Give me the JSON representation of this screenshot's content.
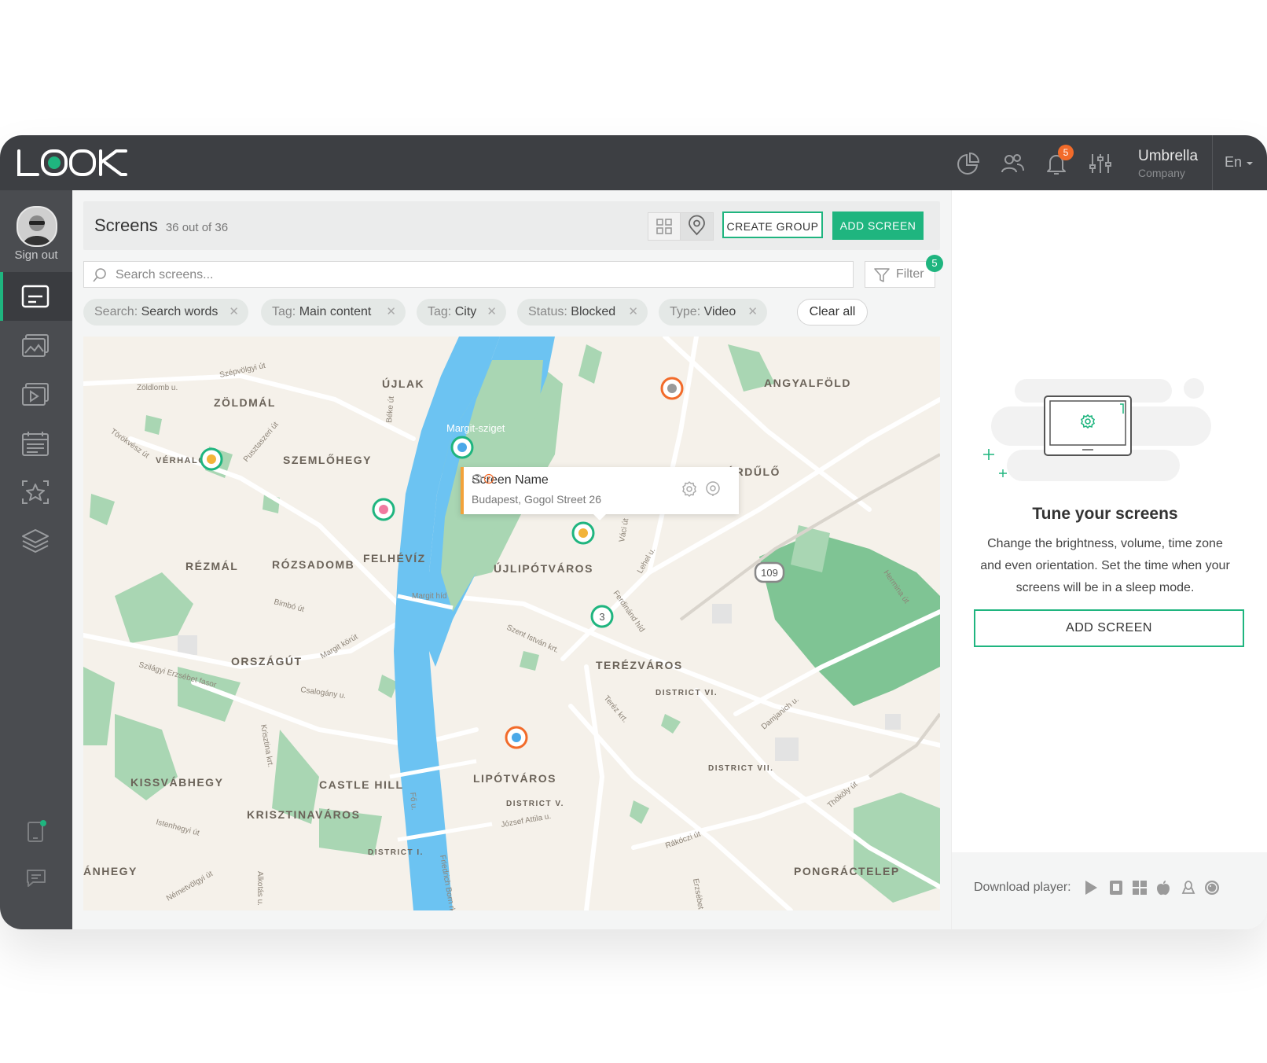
{
  "topbar": {
    "logo_text": "LOOK",
    "notifications_count": "5",
    "company_name": "Umbrella",
    "company_sub": "Company",
    "language": "En"
  },
  "sidebar": {
    "sign_out": "Sign out",
    "items": [
      "screens",
      "media",
      "playlists",
      "schedule",
      "templates",
      "layers"
    ]
  },
  "header": {
    "title": "Screens",
    "count": "36 out of 36",
    "create_group": "CREATE GROUP",
    "add_screen": "ADD SCREEN"
  },
  "search": {
    "placeholder": "Search screens...",
    "filter_label": "Filter",
    "filter_count": "5"
  },
  "chips": [
    {
      "key": "Search:",
      "value": "Search words"
    },
    {
      "key": "Tag:",
      "value": "Main content"
    },
    {
      "key": "Tag:",
      "value": "City"
    },
    {
      "key": "Status:",
      "value": "Blocked"
    },
    {
      "key": "Type:",
      "value": "Video"
    }
  ],
  "clear_all": "Clear all",
  "map": {
    "labels": [
      "ÚJLAK",
      "ZÖLDMÁL",
      "SZEMLŐHEGY",
      "VÉRHALOM",
      "RÉZMÁL",
      "RÓZSADOMB",
      "FELHÉVÍZ",
      "ÚJLIPÓTVÁROS",
      "ANGYALFÖLD",
      "TÁRDŰLŐ",
      "TERÉZVÁROS",
      "ORSZÁGÚT",
      "KISSVÁBHEGY",
      "CASTLE HILL",
      "KRISZTINAVÁROS",
      "LIPÓTVÁROS",
      "PONGRÁCTELEP",
      "ÁNHEGY",
      "DISTRICT VI.",
      "DISTRICT VII.",
      "DISTRICT V.",
      "DISTRICT I.",
      "Margit-sziget"
    ],
    "streets": [
      "Zöldlomb u.",
      "Szépvölgyi út",
      "Törökvész út",
      "Pusztaszeri út",
      "Bimbó út",
      "Szilágyi Erzsébet fasor",
      "Csalogány u.",
      "Margit körút",
      "Szent István krt.",
      "Teréz krt.",
      "Váci út",
      "Lehel u.",
      "Dózsa György út",
      "Rákóczi út",
      "Thököly út",
      "Damjanich u.",
      "Alkotás u.",
      "Krisztina krt.",
      "Fő u.",
      "Attila út",
      "Margit híd",
      "Istenhegyi út",
      "Németvölgyi út",
      "Ferdinánd híd",
      "Béke út",
      "Hermina út",
      "Aréna út",
      "Erzsébet krt.",
      "József Attila u.",
      "Friedrich Born rkp."
    ],
    "road_shield": "109",
    "cluster_count": "3",
    "pins": [
      {
        "ring": "#f26b2a",
        "dot": "#9a9a9a"
      },
      {
        "ring": "#1fb57f",
        "dot": "#f2b43a"
      },
      {
        "ring": "#1fb57f",
        "dot": "#4aa8e8"
      },
      {
        "ring": "#1fb57f",
        "dot": "#f07aa0"
      },
      {
        "ring": "#1fb57f",
        "dot": "#f2b43a"
      },
      {
        "ring": "#f26b2a",
        "dot": "#4aa8e8"
      }
    ],
    "popup": {
      "name": "Screen Name",
      "address": "Budapest, Gogol Street 26"
    }
  },
  "right_panel": {
    "title": "Tune your screens",
    "description": "Change the brightness, volume, time zone and even orientation. Set the time when your screens will be in a sleep mode.",
    "add_screen": "ADD SCREEN",
    "download_label": "Download player:",
    "platforms": [
      "android-icon",
      "samsung-icon",
      "windows-icon",
      "apple-icon",
      "linux-icon",
      "lg-icon"
    ]
  },
  "colors": {
    "accent": "#1fb57f",
    "topbar": "#3d3f43",
    "sidebar": "#4a4c50",
    "notification": "#f26b2a",
    "river": "#5bb8f0",
    "park": "#86c79a"
  }
}
